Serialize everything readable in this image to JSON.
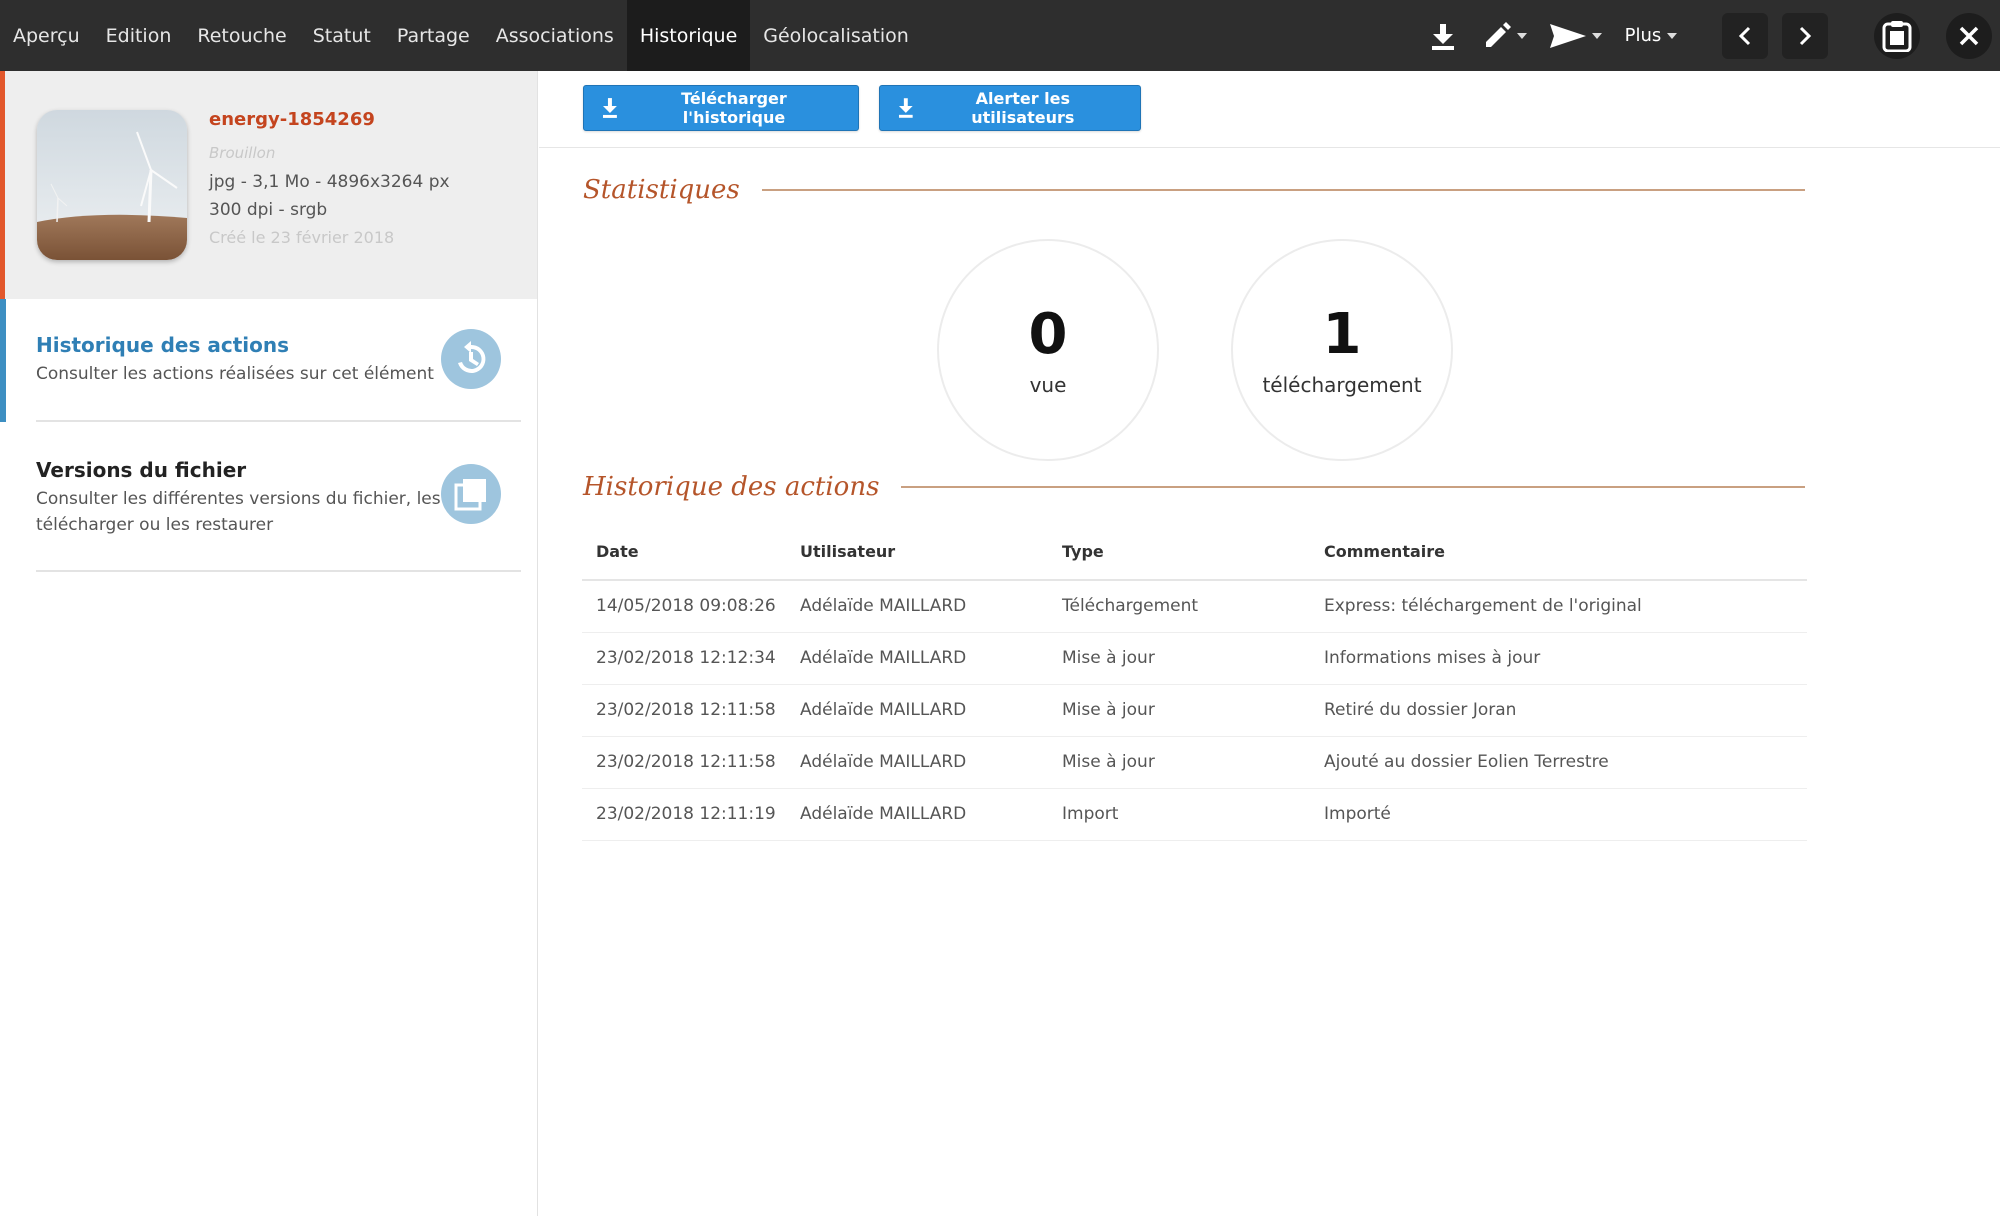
{
  "nav": {
    "tabs": [
      {
        "label": "Aperçu"
      },
      {
        "label": "Edition"
      },
      {
        "label": "Retouche"
      },
      {
        "label": "Statut"
      },
      {
        "label": "Partage"
      },
      {
        "label": "Associations"
      },
      {
        "label": "Historique",
        "active": true
      },
      {
        "label": "Géolocalisation"
      }
    ],
    "tools": {
      "download_icon": "download-icon",
      "edit_icon": "pencil-icon",
      "send_icon": "send-icon",
      "more_label": "Plus",
      "prev_icon": "chevron-left-icon",
      "next_icon": "chevron-right-icon",
      "clipboard_icon": "clipboard-icon",
      "close_icon": "close-icon"
    }
  },
  "asset": {
    "name": "energy-1854269",
    "status": "Brouillon",
    "meta_line1": "jpg - 3,1 Mo - 4896x3264 px",
    "meta_line2": "300 dpi - srgb",
    "created": "Créé le 23 février 2018",
    "accent_color": "#e2572b"
  },
  "sidebar": {
    "items": [
      {
        "title": "Historique des actions",
        "description": "Consulter les actions réalisées sur cet élément",
        "icon": "history-icon",
        "active": true
      },
      {
        "title": "Versions du fichier",
        "description_line1": "Consulter les différentes versions du fichier, les",
        "description_line2": "télécharger ou les restaurer",
        "icon": "versions-icon"
      }
    ]
  },
  "toolbar": {
    "download_history_label": "Télécharger l'historique",
    "alert_users_label": "Alerter les utilisateurs",
    "button_color": "#2a90de"
  },
  "stats": {
    "title": "Statistiques",
    "views": {
      "value": "0",
      "label": "vue"
    },
    "downloads": {
      "value": "1",
      "label": "téléchargement"
    }
  },
  "history": {
    "title": "Historique des actions",
    "columns": [
      "Date",
      "Utilisateur",
      "Type",
      "Commentaire"
    ],
    "rows": [
      [
        "14/05/2018 09:08:26",
        "Adélaïde MAILLARD",
        "Téléchargement",
        "Express: téléchargement de l'original"
      ],
      [
        "23/02/2018 12:12:34",
        "Adélaïde MAILLARD",
        "Mise à jour",
        "Informations mises à jour"
      ],
      [
        "23/02/2018 12:11:58",
        "Adélaïde MAILLARD",
        "Mise à jour",
        "Retiré du dossier Joran"
      ],
      [
        "23/02/2018 12:11:58",
        "Adélaïde MAILLARD",
        "Mise à jour",
        "Ajouté au dossier Eolien Terrestre"
      ],
      [
        "23/02/2018 12:11:19",
        "Adélaïde MAILLARD",
        "Import",
        "Importé"
      ]
    ]
  }
}
